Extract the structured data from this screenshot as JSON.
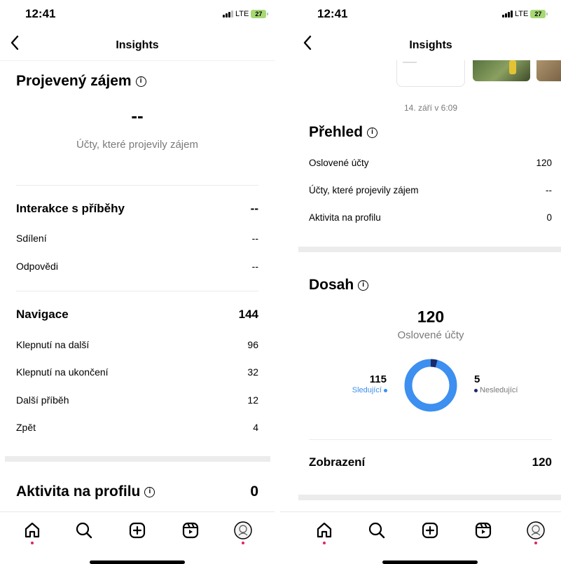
{
  "left": {
    "status": {
      "time": "12:41",
      "network": "LTE",
      "battery": "27"
    },
    "header": {
      "title": "Insights"
    },
    "interest": {
      "title": "Projevený zájem",
      "value": "--",
      "subtitle": "Účty, které projevily zájem"
    },
    "story_interactions": {
      "title": "Interakce s příběhy",
      "total": "--",
      "rows": [
        {
          "label": "Sdílení",
          "value": "--"
        },
        {
          "label": "Odpovědi",
          "value": "--"
        }
      ]
    },
    "navigation": {
      "title": "Navigace",
      "total": "144",
      "rows": [
        {
          "label": "Klepnutí na další",
          "value": "96"
        },
        {
          "label": "Klepnutí na ukončení",
          "value": "32"
        },
        {
          "label": "Další příběh",
          "value": "12"
        },
        {
          "label": "Zpět",
          "value": "4"
        }
      ]
    },
    "profile_activity": {
      "title": "Aktivita na profilu",
      "value": "0"
    }
  },
  "right": {
    "status": {
      "time": "12:41",
      "network": "LTE",
      "battery": "27"
    },
    "header": {
      "title": "Insights"
    },
    "date": "14. září v 6:09",
    "overview": {
      "title": "Přehled",
      "rows": [
        {
          "label": "Oslovené účty",
          "value": "120"
        },
        {
          "label": "Účty, které projevily zájem",
          "value": "--"
        },
        {
          "label": "Aktivita na profilu",
          "value": "0"
        }
      ]
    },
    "reach": {
      "title": "Dosah",
      "total": "120",
      "total_label": "Oslovené účty",
      "followers": {
        "value": "115",
        "label": "Sledující",
        "color": "#3d8ff0"
      },
      "non_followers": {
        "value": "5",
        "label": "Nesledující",
        "color": "#1a2a6b"
      }
    },
    "impressions": {
      "title": "Zobrazení",
      "value": "120"
    }
  },
  "tabbar": {
    "icons": [
      "home-icon",
      "search-icon",
      "create-icon",
      "reels-icon",
      "profile-avatar"
    ]
  },
  "colors": {
    "accent": "#3d8ff0",
    "dark_accent": "#1a2a6b",
    "notification_dot": "#e0245e"
  }
}
